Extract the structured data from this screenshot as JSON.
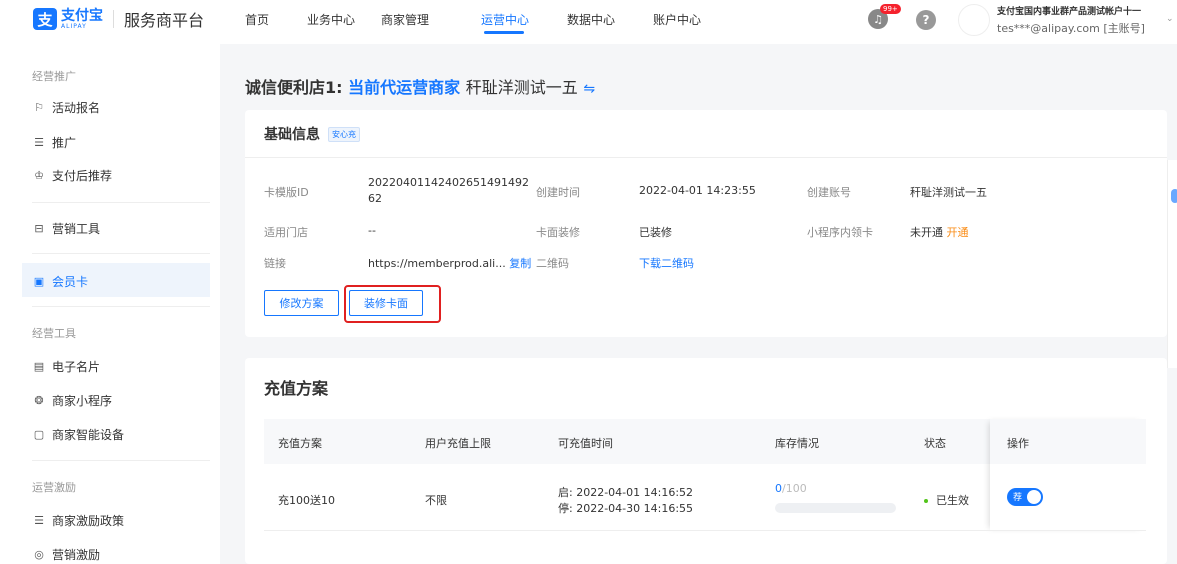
{
  "header": {
    "logo_cn": "支付宝",
    "logo_en": "ALIPAY",
    "platform": "服务商平台",
    "nav": [
      "首页",
      "业务中心",
      "商家管理",
      "运营中心",
      "数据中心",
      "账户中心"
    ],
    "active_nav": "运营中心",
    "notify_badge": "99+",
    "help": "?",
    "account_name": "支付宝国内事业群产品测试帐户十一",
    "account_email": "tes***@alipay.com [主账号]",
    "chevron": "⌄"
  },
  "sidebar": {
    "group1": "经营推广",
    "items1": [
      {
        "label": "活动报名",
        "icon": "flag-icon"
      },
      {
        "label": "推广",
        "icon": "document-icon"
      },
      {
        "label": "支付后推荐",
        "icon": "crown-icon"
      }
    ],
    "marketing_tool": {
      "label": "营销工具",
      "icon": "gift-box-icon"
    },
    "member_card": {
      "label": "会员卡",
      "icon": "card-icon"
    },
    "group2": "经营工具",
    "items2": [
      {
        "label": "电子名片",
        "icon": "id-card-icon"
      },
      {
        "label": "商家小程序",
        "icon": "cube-icon"
      },
      {
        "label": "商家智能设备",
        "icon": "device-icon"
      }
    ],
    "group3": "运营激励",
    "items3": [
      {
        "label": "商家激励政策",
        "icon": "document-icon"
      },
      {
        "label": "营销激励",
        "icon": "badge-icon"
      }
    ]
  },
  "page": {
    "store": "诚信便利店1:",
    "role": "当前代运营商家",
    "merchant": "秆耻洋测试一五",
    "swap_icon": "⇋"
  },
  "basic_info": {
    "title": "基础信息",
    "tag": "安心充",
    "fields": {
      "template_id_label": "卡模版ID",
      "template_id": "20220401142402651491492 62",
      "created_time_label": "创建时间",
      "created_time": "2022-04-01 14:23:55",
      "created_account_label": "创建账号",
      "created_account": "秆耻洋测试一五",
      "store_label": "适用门店",
      "store": "--",
      "decor_label": "卡面装修",
      "decor": "已装修",
      "miniapp_label": "小程序内领卡",
      "miniapp": "未开通",
      "miniapp_action": "开通",
      "link_label": "链接",
      "link": "https://memberprod.ali...",
      "copy": "复制",
      "qrcode_label": "二维码",
      "qrcode_action": "下载二维码"
    },
    "btn_edit_plan": "修改方案",
    "btn_decorate": "装修卡面"
  },
  "recharge": {
    "title": "充值方案",
    "columns": [
      "充值方案",
      "用户充值上限",
      "可充值时间",
      "库存情况",
      "状态",
      "操作"
    ],
    "rows": [
      {
        "plan": "充100送10",
        "limit": "不限",
        "start": "启: 2022-04-01 14:16:52",
        "end": "停: 2022-04-30 14:16:55",
        "stock_used": "0",
        "stock_total": "/100",
        "stock_fraction": 0,
        "status": "已生效",
        "toggle_label": "荐",
        "toggle_on": true
      }
    ]
  },
  "colors": {
    "accent": "#1677ff",
    "danger": "#e02020",
    "warn": "#fa8c16",
    "success": "#52c41a"
  }
}
